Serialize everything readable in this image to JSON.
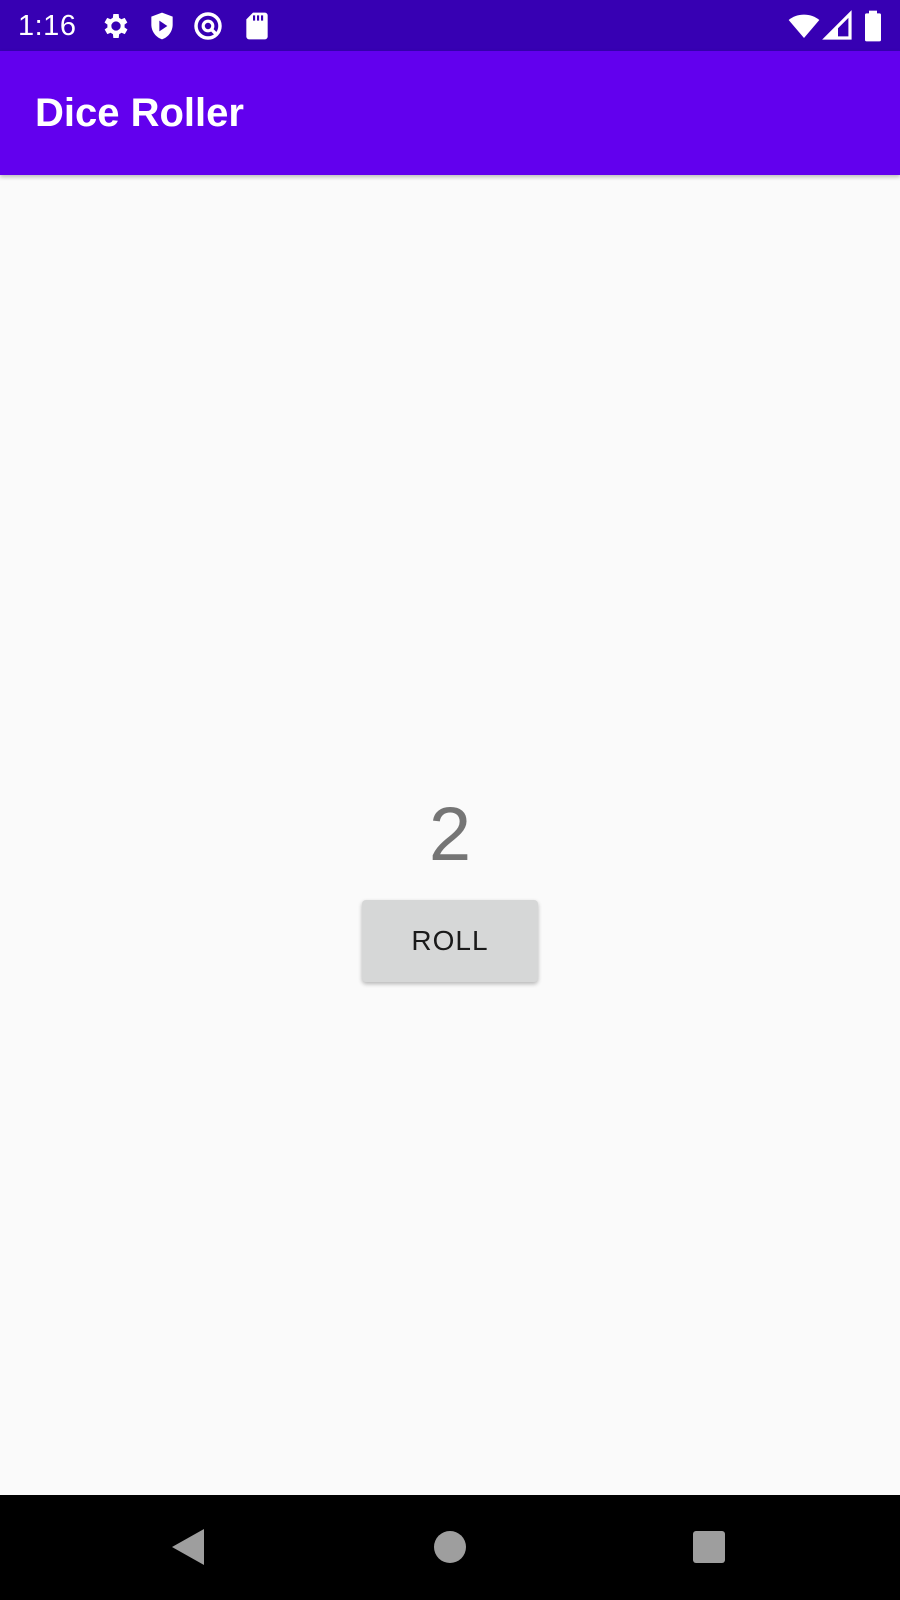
{
  "status_bar": {
    "time": "1:16",
    "left_icons": [
      "gear-icon",
      "shield-play-icon",
      "accessibility-icon",
      "sd-card-icon"
    ],
    "right_icons": [
      "wifi-icon",
      "cell-signal-icon",
      "battery-icon"
    ],
    "color": "#3700b3"
  },
  "app_bar": {
    "title": "Dice Roller",
    "color": "#6200ee"
  },
  "main": {
    "result": "2",
    "roll_button_label": "ROLL"
  },
  "nav_bar": {
    "buttons": [
      "back-icon",
      "home-icon",
      "recents-icon"
    ]
  }
}
